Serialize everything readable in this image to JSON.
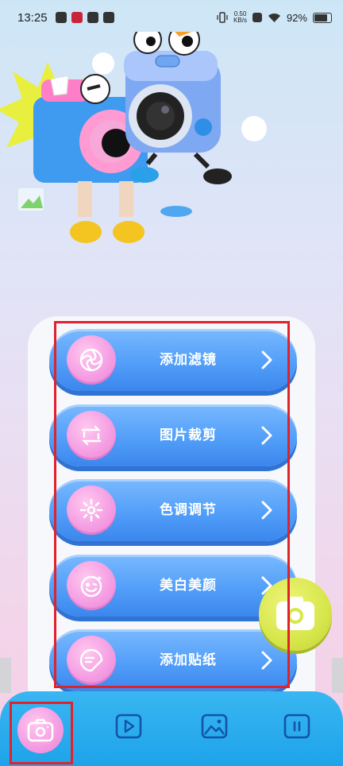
{
  "status_bar": {
    "time": "13:25",
    "net_speed_value": "0.50",
    "net_speed_unit": "KB/s",
    "battery": "92%"
  },
  "menu": {
    "items": [
      {
        "label": "添加滤镜",
        "icon": "flower-filter-icon"
      },
      {
        "label": "图片裁剪",
        "icon": "crop-icon"
      },
      {
        "label": "色调调节",
        "icon": "sun-adjust-icon"
      },
      {
        "label": "美白美颜",
        "icon": "smiley-face-icon"
      },
      {
        "label": "添加贴纸",
        "icon": "sticker-icon"
      }
    ]
  },
  "bottom_nav": {
    "items": [
      {
        "icon": "camera-icon",
        "active": true
      },
      {
        "icon": "play-video-icon",
        "active": false
      },
      {
        "icon": "image-gallery-icon",
        "active": false
      },
      {
        "icon": "pause-menu-icon",
        "active": false
      }
    ]
  },
  "colors": {
    "button_blue": "#4f9cf8",
    "icon_pink": "#f49be2",
    "fab_lime": "#d7e64a",
    "nav_blue": "#1ea3ea",
    "highlight_red": "#e0222b"
  }
}
